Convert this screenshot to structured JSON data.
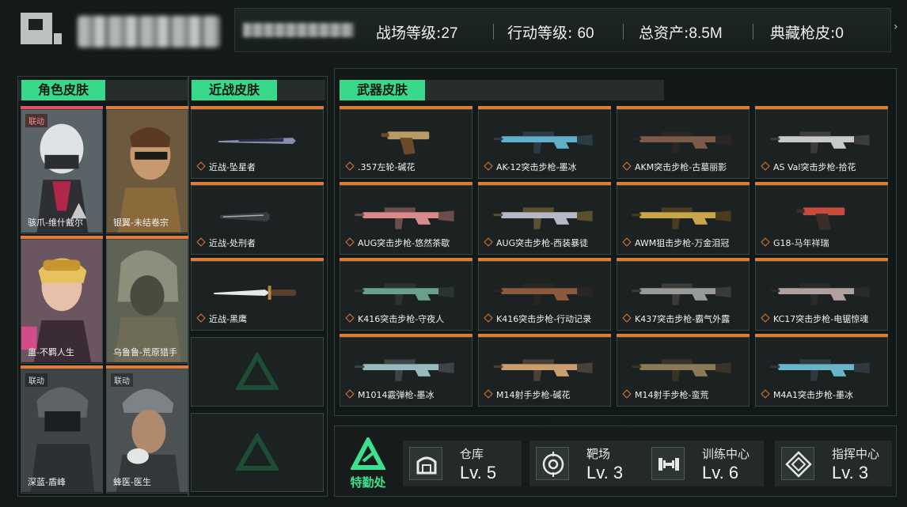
{
  "header": {
    "stats": [
      {
        "label": "战场等级:",
        "value": "27"
      },
      {
        "label": "行动等级: ",
        "value": "60"
      },
      {
        "label": "总资产:",
        "value": "8.5M"
      },
      {
        "label": "典藏枪皮:",
        "value": "0"
      }
    ],
    "more_icon": "chevron-right-icon"
  },
  "character_skins": {
    "title": "角色皮肤",
    "items": [
      {
        "name": "骇爪-维什戴尔",
        "badge": "联动"
      },
      {
        "name": "银翼-未结卷宗",
        "badge": ""
      },
      {
        "name": "蛊-不羁人生",
        "badge": ""
      },
      {
        "name": "乌鲁鲁-荒原猎手",
        "badge": ""
      },
      {
        "name": "深蓝-盾峰",
        "badge": "联动"
      },
      {
        "name": "蜂医-医生",
        "badge": "联动"
      }
    ]
  },
  "melee_skins": {
    "title": "近战皮肤",
    "items": [
      {
        "name": "近战-坠星者"
      },
      {
        "name": "近战-处刑者"
      },
      {
        "name": "近战-黑鹰"
      }
    ]
  },
  "weapon_skins": {
    "title": "武器皮肤",
    "items": [
      {
        "name": ".357左轮-碱花"
      },
      {
        "name": "AK-12突击步枪-墨冰"
      },
      {
        "name": "AKM突击步枪-古墓丽影"
      },
      {
        "name": "AS Val突击步枪-拾花"
      },
      {
        "name": "AUG突击步枪-悠然茶歇"
      },
      {
        "name": "AUG突击步枪-西装暴徒"
      },
      {
        "name": "AWM狙击步枪-万金泪冠"
      },
      {
        "name": "G18-马年祥瑞"
      },
      {
        "name": "K416突击步枪-守夜人"
      },
      {
        "name": "K416突击步枪-行动记录"
      },
      {
        "name": "K437突击步枪-霸气外露"
      },
      {
        "name": "KC17突击步枪-电锯惊魂"
      },
      {
        "name": "M1014霰弹枪-墨冰"
      },
      {
        "name": "M14射手步枪-碱花"
      },
      {
        "name": "M14射手步枪-蛮荒"
      },
      {
        "name": "M4A1突击步枪-墨冰"
      }
    ]
  },
  "facilities": {
    "hq_label": "特勤处",
    "items": [
      {
        "name": "仓库",
        "level": "Lv. 5",
        "icon": "warehouse-icon"
      },
      {
        "name": "靶场",
        "level": "Lv. 3",
        "icon": "target-icon"
      },
      {
        "name": "训练中心",
        "level": "Lv. 6",
        "icon": "dumbbell-icon"
      },
      {
        "name": "指挥中心",
        "level": "Lv. 3",
        "icon": "command-center-icon"
      }
    ]
  },
  "colors": {
    "accent_green": "#38d98a",
    "rarity_orange": "#e07b39",
    "rarity_red": "#e24f6b"
  }
}
